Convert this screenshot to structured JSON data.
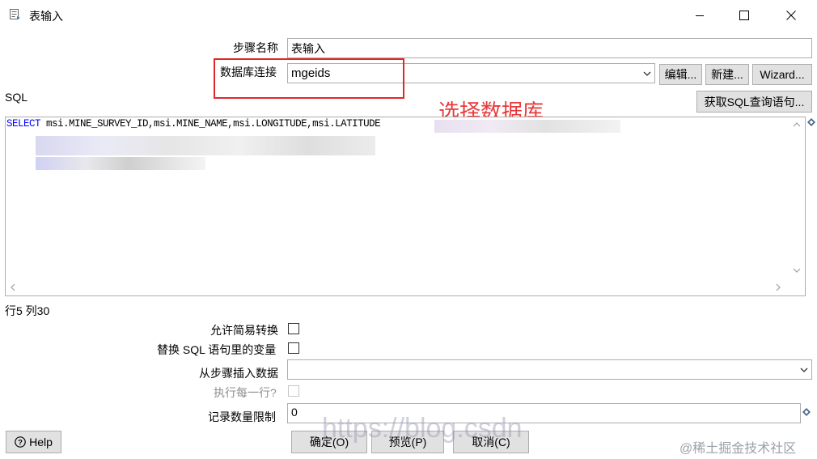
{
  "window": {
    "title": "表输入",
    "controls": {
      "minimize": "—",
      "maximize": "☐",
      "close": "✕"
    }
  },
  "form": {
    "step_name_label": "步骤名称",
    "step_name_value": "表输入",
    "db_connection_label": "数据库连接",
    "db_connection_value": "mgeids",
    "edit_button": "编辑...",
    "new_button": "新建...",
    "wizard_button": "Wizard...",
    "get_sql_button": "获取SQL查询语句...",
    "sql_label": "SQL",
    "sql_text": "SELECT msi.MINE_SURVEY_ID,msi.MINE_NAME,msi.LONGITUDE,msi.LATITUDE",
    "cursor_position": "行5 列30",
    "lazy_conversion_label": "允许简易转换",
    "replace_vars_label": "替换 SQL 语句里的变量",
    "insert_from_step_label": "从步骤插入数据",
    "insert_from_step_value": "",
    "execute_each_row_label": "执行每一行?",
    "limit_label": "记录数量限制",
    "limit_value": "0"
  },
  "annotation": {
    "text": "选择数据库",
    "color": "#e83a3a"
  },
  "footer": {
    "help_button": "Help",
    "ok_button": "确定(O)",
    "preview_button": "预览(P)",
    "cancel_button": "取消(C)"
  },
  "watermarks": {
    "url": "https://blog.csdn",
    "community": "@稀土掘金技术社区"
  },
  "colors": {
    "sql_keyword": "#0000ff",
    "highlight_box": "#e0282a",
    "button_bg": "#e1e1e1"
  }
}
